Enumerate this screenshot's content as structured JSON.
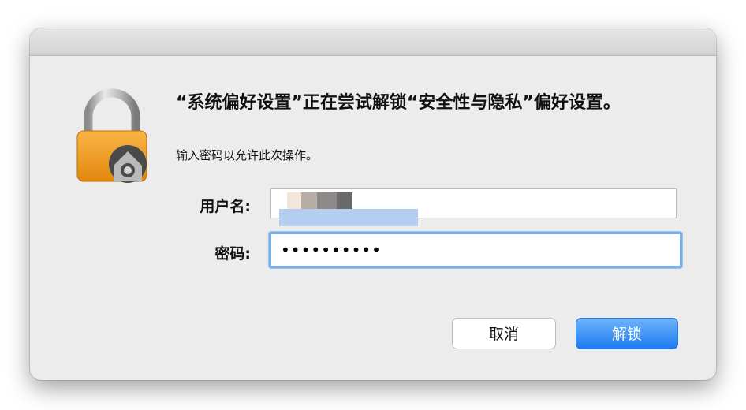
{
  "dialog": {
    "message": "“系统偏好设置”正在尝试解锁“安全性与隐私”偏好设置。",
    "hint": "输入密码以允许此次操作。"
  },
  "form": {
    "username_label": "用户名:",
    "username_value": "",
    "password_label": "密码:",
    "password_value": "••••••••••"
  },
  "buttons": {
    "cancel_label": "取消",
    "unlock_label": "解锁"
  },
  "icons": {
    "lock": "lock-icon"
  },
  "colors": {
    "accent": "#1e7bf1",
    "focus_ring": "#7aaee8",
    "background": "#ececec"
  }
}
